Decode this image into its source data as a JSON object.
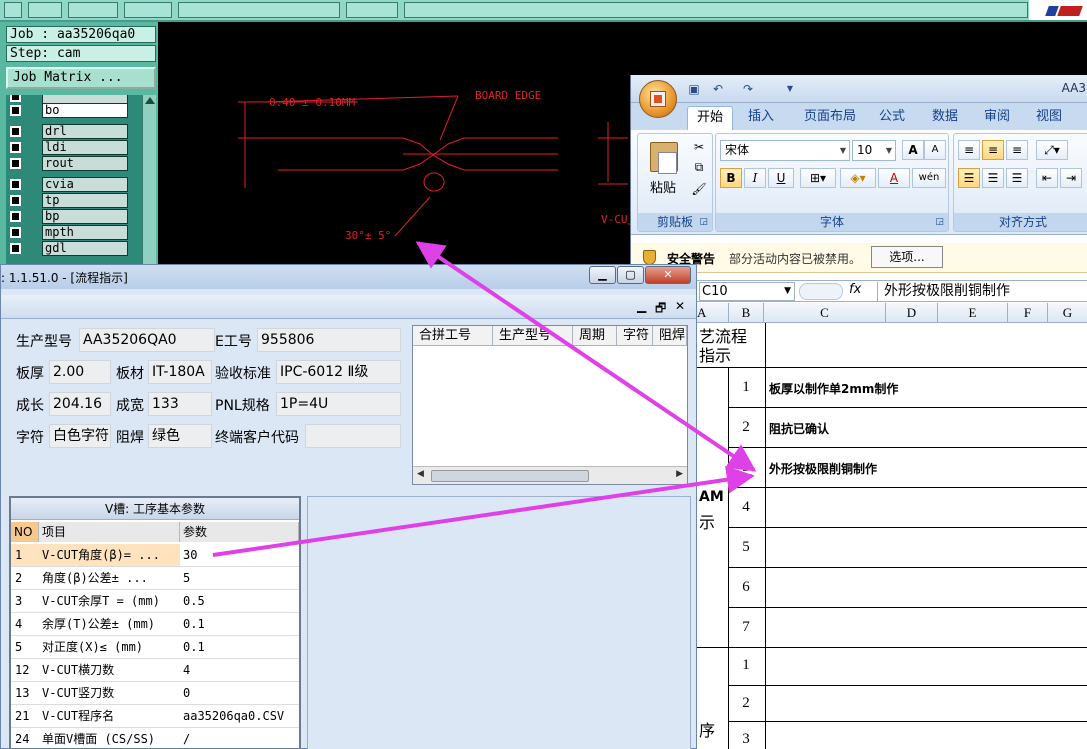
{
  "cam": {
    "job_label": "Job : aa35206qa0",
    "step_label": "Step: cam",
    "job_matrix_button": "Job Matrix ...",
    "layers": [
      {
        "name": "bo"
      },
      {
        "name": "drl"
      },
      {
        "name": "ldi"
      },
      {
        "name": "rout"
      },
      {
        "name": "cvia"
      },
      {
        "name": "tp"
      },
      {
        "name": "bp"
      },
      {
        "name": "mpth"
      },
      {
        "name": "gdl"
      }
    ],
    "drawing": {
      "dim_tolerance": "0.40 ± 0.10MM",
      "board_edge": "BOARD EDGE",
      "angle": "30°± 5°",
      "vcut": "V-CU"
    },
    "drawing_color": "#e0202a"
  },
  "excel": {
    "title": "AA3",
    "tabs": [
      "开始",
      "插入",
      "页面布局",
      "公式",
      "数据",
      "审阅",
      "视图"
    ],
    "active_tab": "开始",
    "ribbon": {
      "paste_label": "粘贴",
      "clipboard_label": "剪贴板",
      "font_name": "宋体",
      "font_size": "10",
      "font_group_label": "字体",
      "align_group_label": "对齐方式",
      "bold": "B",
      "italic": "I",
      "underline": "U",
      "grow_font": "A",
      "shrink_font": "A",
      "font_color": "A",
      "phonetic": "wén"
    },
    "security": {
      "title": "安全警告",
      "message": "部分活动内容已被禁用。",
      "options_button": "选项..."
    },
    "name_box": "C10",
    "fx": "fx",
    "formula": "外形按极限削铜制作",
    "columns": [
      "A",
      "B",
      "C",
      "D",
      "E",
      "F",
      "G"
    ],
    "col_a_texts": [
      "艺流程",
      "指示",
      "AM",
      "示",
      "序"
    ],
    "rows": [
      {
        "num": "1",
        "text": "板厚以制作单2mm制作"
      },
      {
        "num": "2",
        "text": "阻抗已确认"
      },
      {
        "num": "3",
        "text": "外形按极限削铜制作"
      },
      {
        "num": "4",
        "text": ""
      },
      {
        "num": "5",
        "text": ""
      },
      {
        "num": "6",
        "text": ""
      },
      {
        "num": "7",
        "text": ""
      },
      {
        "num": "1",
        "text": ""
      },
      {
        "num": "2",
        "text": ""
      },
      {
        "num": "3",
        "text": ""
      }
    ]
  },
  "flow": {
    "title": ": 1.1.51.0 - [流程指示]",
    "info": {
      "model_label": "生产型号",
      "model_value": "AA35206QA0",
      "eno_label": "E工号",
      "eno_value": "955806",
      "thick_label": "板厚",
      "thick_value": "2.00",
      "material_label": "板材",
      "material_value": "IT-180A",
      "standard_label": "验收标准",
      "standard_value": "IPC-6012 Ⅱ级",
      "length_label": "成长",
      "length_value": "204.16",
      "width_label": "成宽",
      "width_value": "133",
      "pnl_label": "PNL规格",
      "pnl_value": "1P=4U",
      "char_label": "字符",
      "char_value": "白色字符",
      "mask_label": "阻焊",
      "mask_value": "绿色",
      "customer_label": "终端客户代码",
      "customer_value": ""
    },
    "merge_table_headers": [
      "合拼工号",
      "生产型号",
      "周期",
      "字符",
      "阻焊"
    ],
    "vcut": {
      "title": "V槽: 工序基本参数",
      "headers": [
        "NO",
        "项目",
        "参数"
      ],
      "rows": [
        {
          "no": "1",
          "item": "V-CUT角度(β)= ...",
          "param": "30"
        },
        {
          "no": "2",
          "item": "角度(β)公差± ...",
          "param": "5"
        },
        {
          "no": "3",
          "item": "V-CUT余厚T = (mm)",
          "param": "0.5"
        },
        {
          "no": "4",
          "item": "余厚(T)公差± (mm)",
          "param": "0.1"
        },
        {
          "no": "5",
          "item": "对正度(X)≤ (mm)",
          "param": "0.1"
        },
        {
          "no": "12",
          "item": "V-CUT横刀数",
          "param": "4"
        },
        {
          "no": "13",
          "item": "V-CUT竖刀数",
          "param": "0"
        },
        {
          "no": "21",
          "item": "V-CUT程序名",
          "param": "aa35206qa0.CSV"
        },
        {
          "no": "24",
          "item": "单面V槽面 (CS/SS)",
          "param": "/"
        }
      ]
    }
  },
  "annotation_color": "#e040e8"
}
